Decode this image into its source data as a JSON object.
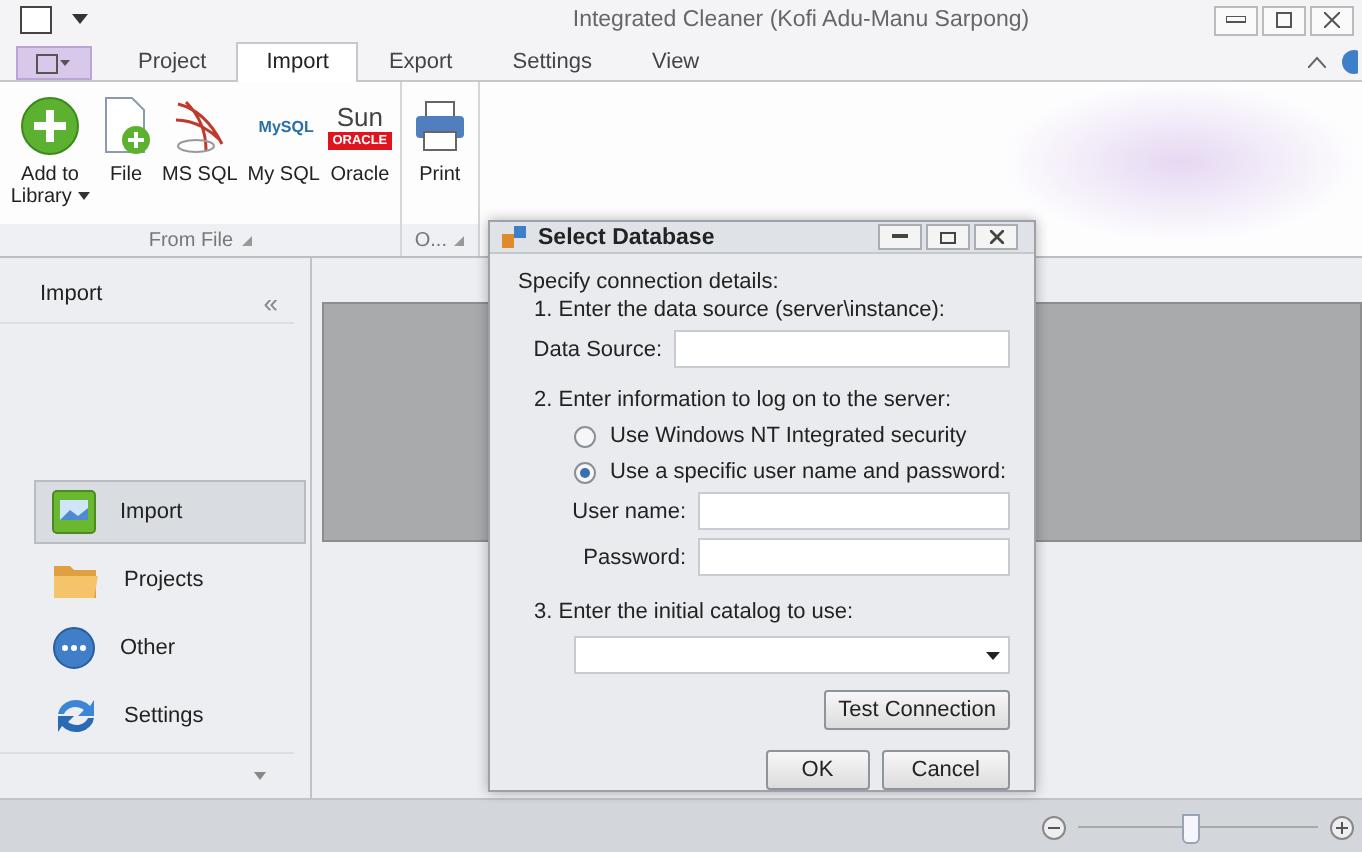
{
  "window": {
    "title": "Integrated Cleaner (Kofi Adu-Manu Sarpong)"
  },
  "ribbon": {
    "tabs": [
      {
        "label": "Project",
        "selected": false
      },
      {
        "label": "Import",
        "selected": true
      },
      {
        "label": "Export",
        "selected": false
      },
      {
        "label": "Settings",
        "selected": false
      },
      {
        "label": "View",
        "selected": false
      }
    ],
    "groups": [
      {
        "label": "From File",
        "items": [
          {
            "kind": "add",
            "label": "Add to Library",
            "dropdown": true
          },
          {
            "kind": "file",
            "label": "File"
          },
          {
            "kind": "mssql",
            "label": "MS SQL"
          },
          {
            "kind": "mysql",
            "label": "My SQL",
            "logo_lines": [
              "MySQL"
            ]
          },
          {
            "kind": "oracle",
            "label": "Oracle",
            "logo_lines": [
              "Sun",
              "ORACLE"
            ]
          }
        ]
      },
      {
        "label": "O...",
        "items": [
          {
            "kind": "print",
            "label": "Print"
          }
        ]
      }
    ]
  },
  "sidebar": {
    "header": "Import",
    "collapse": "«",
    "items": [
      {
        "kind": "import",
        "label": "Import",
        "selected": true
      },
      {
        "kind": "projects",
        "label": "Projects",
        "selected": false
      },
      {
        "kind": "other",
        "label": "Other",
        "selected": false
      },
      {
        "kind": "settings",
        "label": "Settings",
        "selected": false
      }
    ]
  },
  "dialog": {
    "title": "Select Database",
    "intro": "Specify connection details:",
    "step1": "1. Enter the data source (server\\instance):",
    "data_source": {
      "label": "Data Source:"
    },
    "step2": "2. Enter information to log on to the server:",
    "auth_options": [
      {
        "label": "Use Windows NT Integrated security",
        "selected": false
      },
      {
        "label": "Use a specific user name and password:",
        "selected": true
      }
    ],
    "credentials": [
      {
        "label": "User name:"
      },
      {
        "label": "Password:"
      }
    ],
    "step3": "3. Enter the initial catalog to use:",
    "test_button": "Test Connection",
    "buttons": [
      "OK",
      "Cancel"
    ]
  },
  "status_bar": {
    "zoom": {
      "level": 0.47
    }
  }
}
